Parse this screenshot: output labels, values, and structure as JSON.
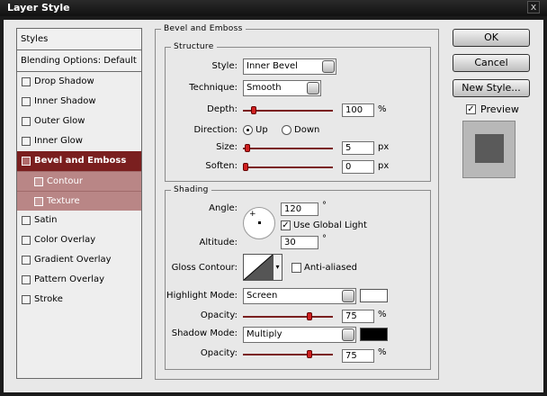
{
  "window": {
    "title": "Layer Style",
    "close_glyph": "x"
  },
  "styles_panel": {
    "header": "Styles",
    "blending_options": "Blending Options: Default",
    "items": [
      {
        "label": "Drop Shadow",
        "checked": false
      },
      {
        "label": "Inner Shadow",
        "checked": false
      },
      {
        "label": "Outer Glow",
        "checked": false
      },
      {
        "label": "Inner Glow",
        "checked": false
      },
      {
        "label": "Bevel and Emboss",
        "checked": false,
        "selected": true
      },
      {
        "label": "Contour",
        "checked": false
      },
      {
        "label": "Texture",
        "checked": false
      },
      {
        "label": "Satin",
        "checked": false
      },
      {
        "label": "Color Overlay",
        "checked": false
      },
      {
        "label": "Gradient Overlay",
        "checked": false
      },
      {
        "label": "Pattern Overlay",
        "checked": false
      },
      {
        "label": "Stroke",
        "checked": false
      }
    ]
  },
  "bevel": {
    "title": "Bevel and Emboss",
    "structure": {
      "title": "Structure",
      "style_label": "Style:",
      "style_value": "Inner Bevel",
      "technique_label": "Technique:",
      "technique_value": "Smooth",
      "depth_label": "Depth:",
      "depth_value": "100",
      "depth_unit": "%",
      "depth_level": 0.1,
      "direction_label": "Direction:",
      "direction_up": "Up",
      "direction_down": "Down",
      "direction_selected": "Up",
      "size_label": "Size:",
      "size_value": "5",
      "size_unit": "px",
      "size_level": 0.02,
      "soften_label": "Soften:",
      "soften_value": "0",
      "soften_unit": "px",
      "soften_level": 0
    },
    "shading": {
      "title": "Shading",
      "angle_label": "Angle:",
      "angle_value": "120",
      "angle_unit": "°",
      "use_global_light_label": "Use Global Light",
      "use_global_light": true,
      "altitude_label": "Altitude:",
      "altitude_value": "30",
      "altitude_unit": "°",
      "gloss_contour_label": "Gloss Contour:",
      "anti_aliased_label": "Anti-aliased",
      "anti_aliased": false,
      "highlight_mode_label": "Highlight Mode:",
      "highlight_mode_value": "Screen",
      "highlight_color": "#ffffff",
      "highlight_opacity_label": "Opacity:",
      "highlight_opacity_value": "75",
      "highlight_opacity_unit": "%",
      "highlight_opacity_level": 0.75,
      "shadow_mode_label": "Shadow Mode:",
      "shadow_mode_value": "Multiply",
      "shadow_color": "#000000",
      "shadow_opacity_label": "Opacity:",
      "shadow_opacity_value": "75",
      "shadow_opacity_unit": "%",
      "shadow_opacity_level": 0.75
    }
  },
  "buttons": {
    "ok": "OK",
    "cancel": "Cancel",
    "new_style": "New Style..."
  },
  "preview": {
    "label": "Preview",
    "checked": true
  },
  "colors": {
    "selected_item": "#7a1f1f",
    "sub_item": "#b98686",
    "slider_thumb": "#d02020"
  }
}
